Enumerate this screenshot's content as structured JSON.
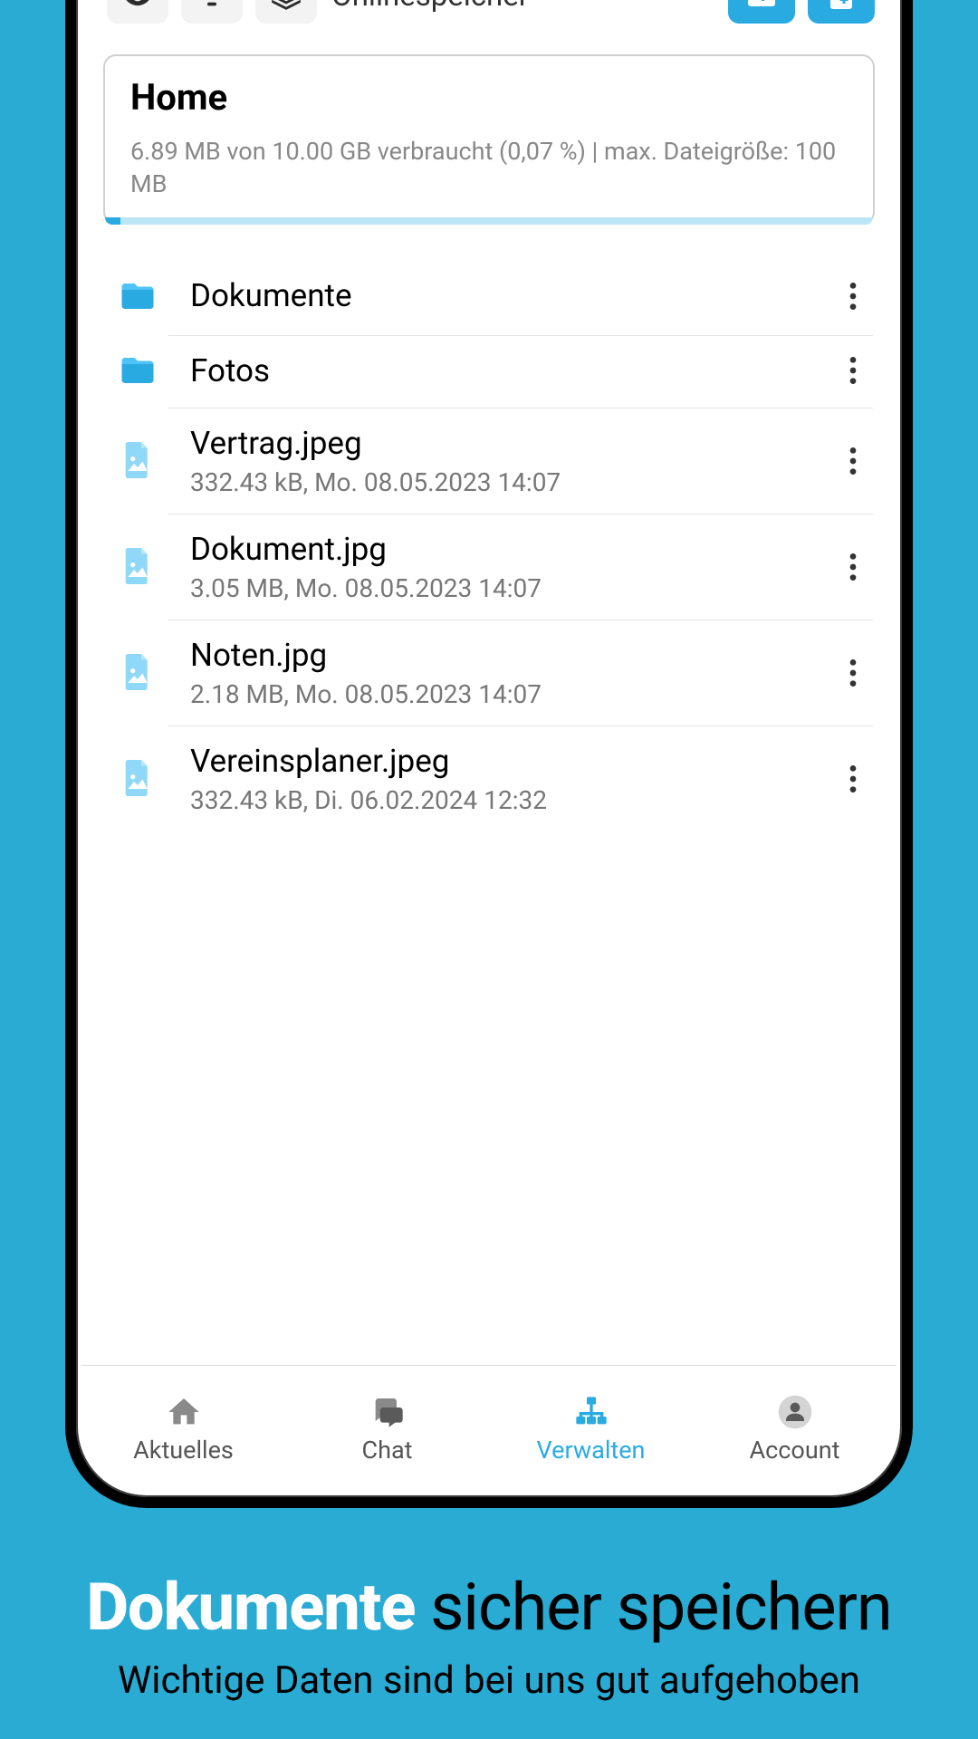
{
  "toolbar": {
    "storage_label": "Onlinespeicher"
  },
  "home": {
    "title": "Home",
    "usage_line": "6.89 MB von 10.00 GB verbraucht  (0,07 %)  | max. Dateigröße: 100 MB"
  },
  "items": [
    {
      "type": "folder",
      "name": "Dokumente",
      "meta": ""
    },
    {
      "type": "folder",
      "name": "Fotos",
      "meta": ""
    },
    {
      "type": "image",
      "name": "Vertrag.jpeg",
      "meta": "332.43 kB, Mo. 08.05.2023 14:07"
    },
    {
      "type": "image",
      "name": "Dokument.jpg",
      "meta": "3.05 MB, Mo. 08.05.2023 14:07"
    },
    {
      "type": "image",
      "name": "Noten.jpg",
      "meta": "2.18 MB, Mo. 08.05.2023 14:07"
    },
    {
      "type": "image",
      "name": "Vereinsplaner.jpeg",
      "meta": "332.43 kB, Di. 06.02.2024 12:32"
    }
  ],
  "nav": {
    "aktuelles": "Aktuelles",
    "chat": "Chat",
    "verwalten": "Verwalten",
    "account": "Account"
  },
  "promo": {
    "bold": "Dokumente",
    "rest": " sicher speichern",
    "sub": "Wichtige Daten sind bei uns gut aufgehoben"
  },
  "colors": {
    "accent": "#29abe2",
    "bg": "#29abd3"
  }
}
